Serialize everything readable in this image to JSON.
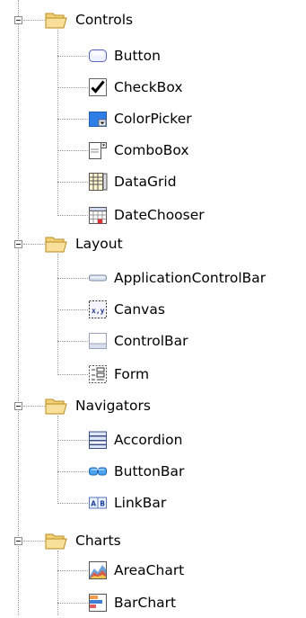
{
  "tree": {
    "groups": [
      {
        "label": "Controls",
        "items": [
          {
            "label": "Button",
            "icon": "button-icon"
          },
          {
            "label": "CheckBox",
            "icon": "checkbox-icon"
          },
          {
            "label": "ColorPicker",
            "icon": "colorpicker-icon"
          },
          {
            "label": "ComboBox",
            "icon": "combobox-icon"
          },
          {
            "label": "DataGrid",
            "icon": "datagrid-icon"
          },
          {
            "label": "DateChooser",
            "icon": "datechooser-icon"
          }
        ]
      },
      {
        "label": "Layout",
        "items": [
          {
            "label": "ApplicationControlBar",
            "icon": "applicationcontrolbar-icon"
          },
          {
            "label": "Canvas",
            "icon": "canvas-icon"
          },
          {
            "label": "ControlBar",
            "icon": "controlbar-icon"
          },
          {
            "label": "Form",
            "icon": "form-icon"
          }
        ]
      },
      {
        "label": "Navigators",
        "items": [
          {
            "label": "Accordion",
            "icon": "accordion-icon"
          },
          {
            "label": "ButtonBar",
            "icon": "buttonbar-icon"
          },
          {
            "label": "LinkBar",
            "icon": "linkbar-icon"
          }
        ]
      },
      {
        "label": "Charts",
        "items": [
          {
            "label": "AreaChart",
            "icon": "areachart-icon"
          },
          {
            "label": "BarChart",
            "icon": "barchart-icon"
          }
        ]
      }
    ]
  }
}
